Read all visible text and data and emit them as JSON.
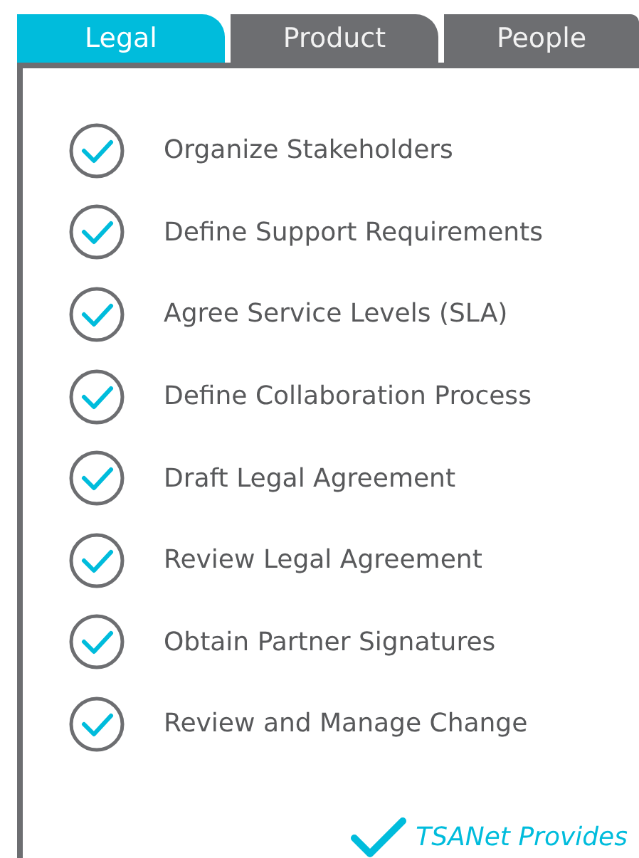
{
  "tabs": [
    {
      "label": "Legal",
      "selected": true
    },
    {
      "label": "Product",
      "selected": false
    },
    {
      "label": "People",
      "selected": false
    }
  ],
  "items": [
    {
      "label": "Organize Stakeholders",
      "checked": true
    },
    {
      "label": "Define Support Requirements",
      "checked": true
    },
    {
      "label": "Agree Service Levels (SLA)",
      "checked": true
    },
    {
      "label": "Define Collaboration Process",
      "checked": true
    },
    {
      "label": "Draft Legal Agreement",
      "checked": true
    },
    {
      "label": "Review Legal Agreement",
      "checked": true
    },
    {
      "label": "Obtain Partner Signatures",
      "checked": true
    },
    {
      "label": "Review and Manage Change",
      "checked": true
    }
  ],
  "legend": {
    "label": "TSANet Provides"
  }
}
